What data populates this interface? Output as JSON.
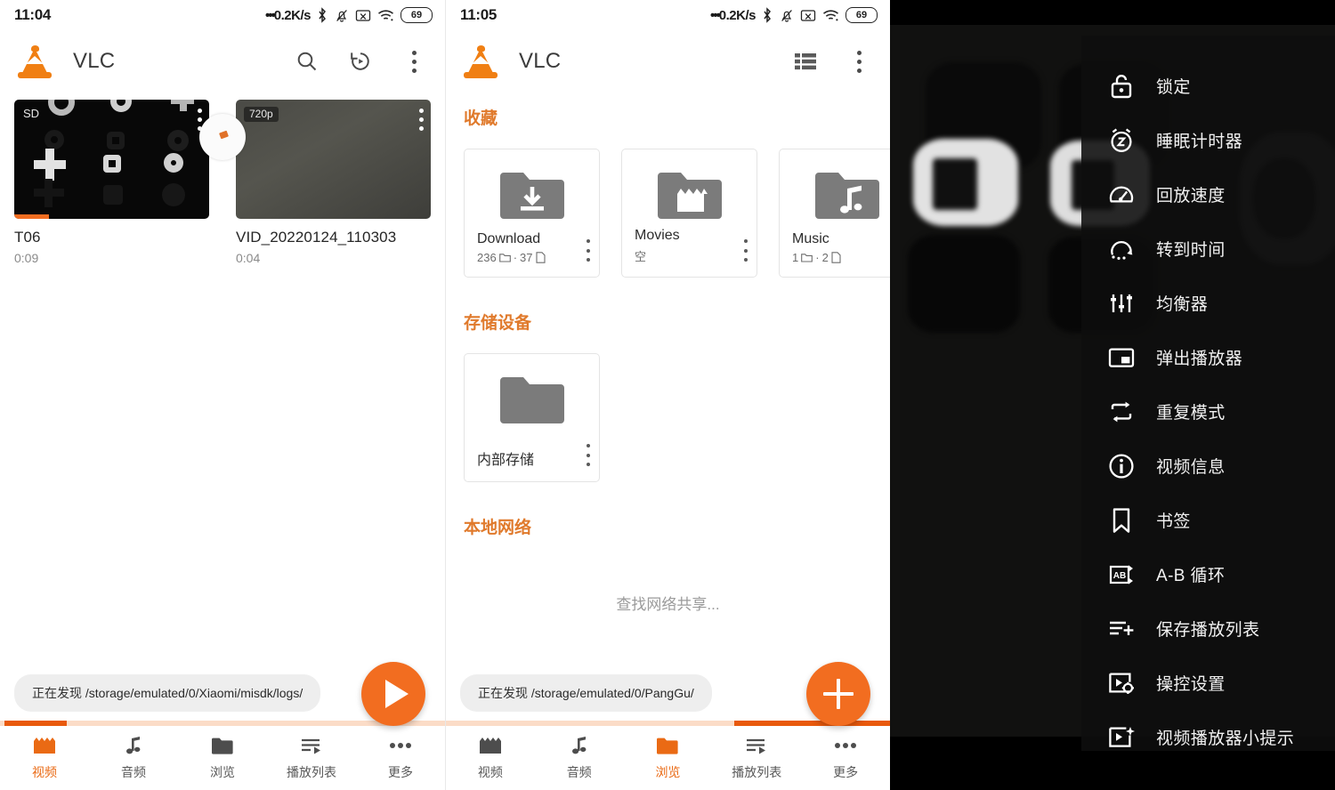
{
  "panel_left": {
    "status": {
      "time": "11:04",
      "net_speed": "0.2K/s",
      "battery": "69"
    },
    "appbar": {
      "title": "VLC"
    },
    "videos": [
      {
        "title": "T06",
        "duration": "0:09",
        "badge": "SD",
        "progress_pct": 18
      },
      {
        "title": "VID_20220124_110303",
        "duration": "0:04",
        "badge": "720p",
        "progress_pct": 0
      }
    ],
    "toast": {
      "prefix": "正在发现",
      "path": "/storage/emulated/0/Xiaomi/misdk/logs/"
    },
    "scan_fill": {
      "left_pct": 1,
      "width_pct": 14
    },
    "fab": {
      "icon": "play-icon"
    },
    "tabs": [
      {
        "label": "视频",
        "icon": "movie-icon",
        "active": true
      },
      {
        "label": "音频",
        "icon": "music-note-icon",
        "active": false
      },
      {
        "label": "浏览",
        "icon": "folder-icon",
        "active": false
      },
      {
        "label": "播放列表",
        "icon": "playlist-icon",
        "active": false
      },
      {
        "label": "更多",
        "icon": "more-dots-icon",
        "active": false
      }
    ]
  },
  "panel_middle": {
    "status": {
      "time": "11:05",
      "net_speed": "0.2K/s",
      "battery": "69"
    },
    "appbar": {
      "title": "VLC"
    },
    "sections": {
      "favorites_title": "收藏",
      "favorites": [
        {
          "name": "Download",
          "folders": "236",
          "files": "37",
          "icon": "folder-download-icon"
        },
        {
          "name": "Movies",
          "meta_text": "空",
          "icon": "folder-movie-icon"
        },
        {
          "name": "Music",
          "folders": "1",
          "files": "2",
          "icon": "folder-music-icon"
        }
      ],
      "storage_title": "存储设备",
      "storage": [
        {
          "name": "内部存储",
          "icon": "folder-icon"
        }
      ],
      "network_title": "本地网络",
      "network_empty": "查找网络共享..."
    },
    "toast": {
      "prefix": "正在发现",
      "path": "/storage/emulated/0/PangGu/"
    },
    "scan_fill": {
      "left_pct": 65,
      "width_pct": 35
    },
    "fab": {
      "icon": "plus-icon"
    },
    "tabs": [
      {
        "label": "视频",
        "icon": "movie-icon",
        "active": false
      },
      {
        "label": "音频",
        "icon": "music-note-icon",
        "active": false
      },
      {
        "label": "浏览",
        "icon": "folder-icon",
        "active": true
      },
      {
        "label": "播放列表",
        "icon": "playlist-icon",
        "active": false
      },
      {
        "label": "更多",
        "icon": "more-dots-icon",
        "active": false
      }
    ]
  },
  "panel_right": {
    "menu_items": [
      {
        "label": "锁定",
        "icon": "lock-icon"
      },
      {
        "label": "睡眠计时器",
        "icon": "sleep-timer-icon"
      },
      {
        "label": "回放速度",
        "icon": "speedometer-icon"
      },
      {
        "label": "转到时间",
        "icon": "jump-to-time-icon"
      },
      {
        "label": "均衡器",
        "icon": "equalizer-icon"
      },
      {
        "label": "弹出播放器",
        "icon": "popup-player-icon"
      },
      {
        "label": "重复模式",
        "icon": "repeat-icon"
      },
      {
        "label": "视频信息",
        "icon": "info-icon"
      },
      {
        "label": "书签",
        "icon": "bookmark-icon"
      },
      {
        "label": "A-B 循环",
        "icon": "ab-loop-icon"
      },
      {
        "label": "保存播放列表",
        "icon": "playlist-add-icon"
      },
      {
        "label": "操控设置",
        "icon": "player-settings-icon"
      },
      {
        "label": "视频播放器小提示",
        "icon": "video-tips-icon"
      }
    ]
  },
  "colors": {
    "accent": "#f26d20",
    "accent_dark": "#e8590c",
    "track": "#fbdcc7",
    "section_header": "#e07a2c"
  }
}
